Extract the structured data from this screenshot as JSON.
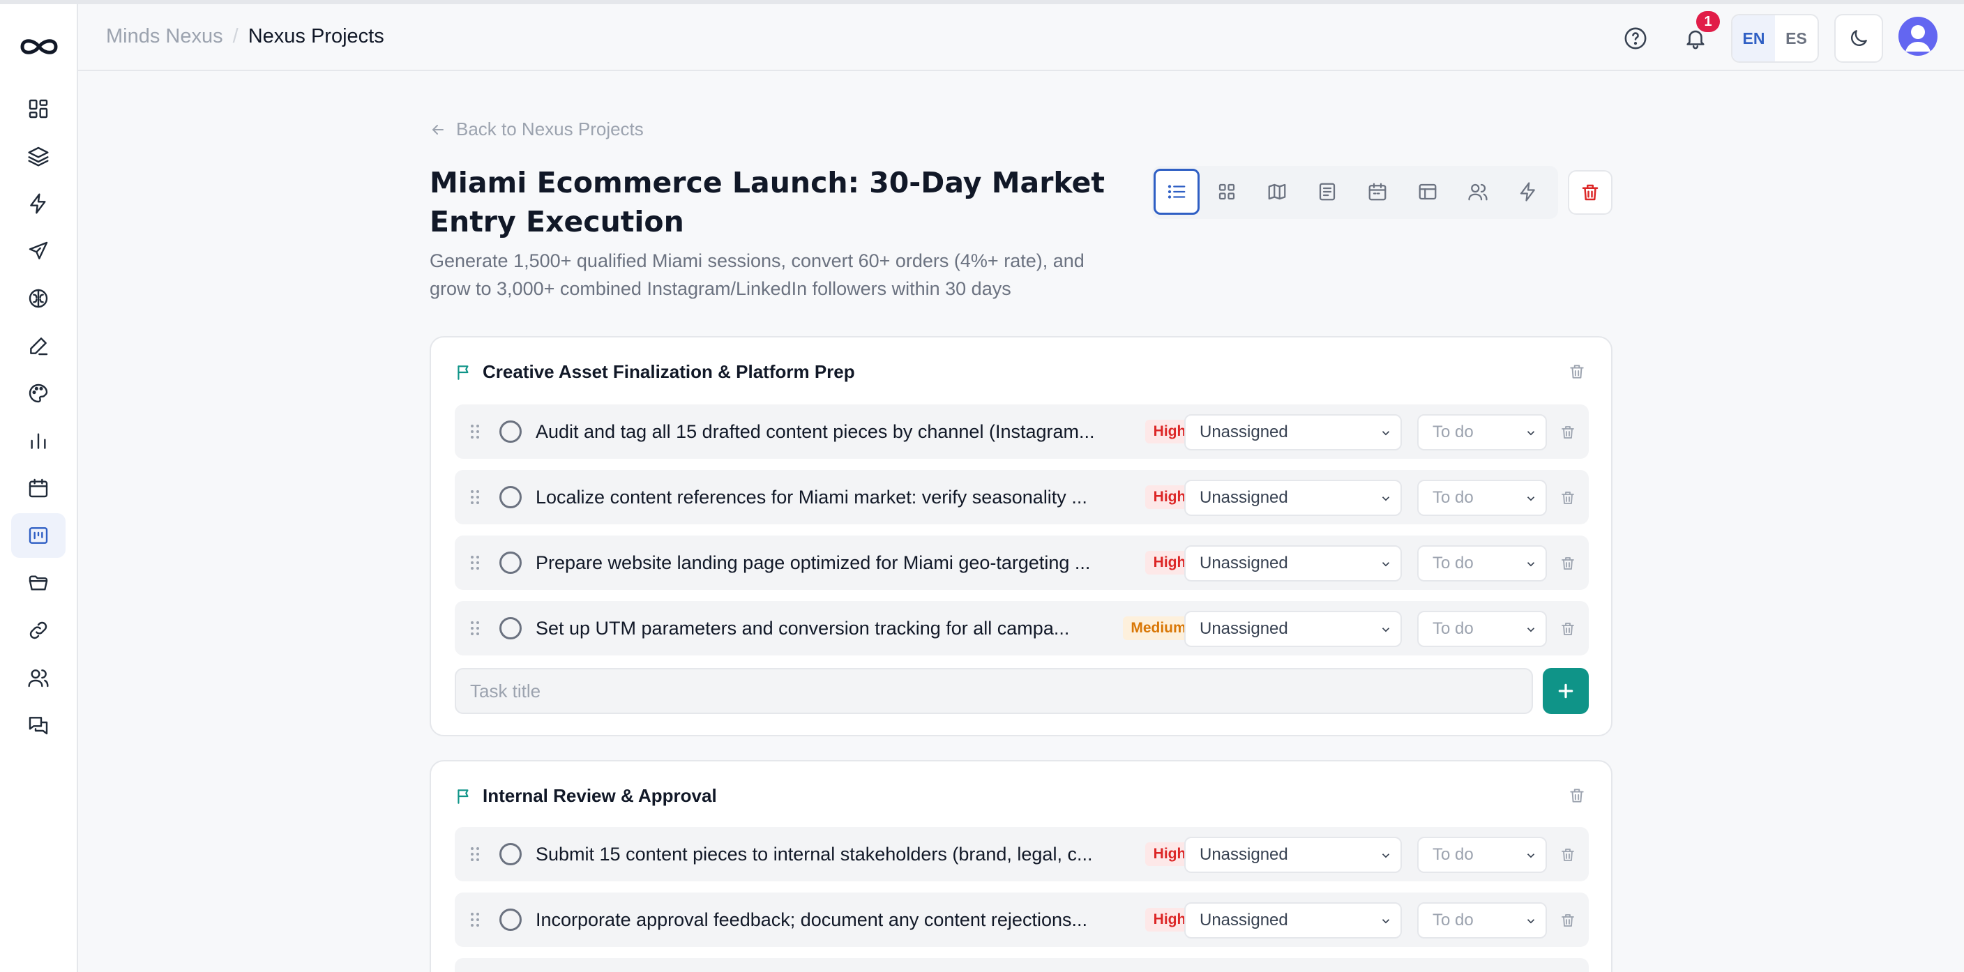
{
  "breadcrumb": {
    "root": "Minds Nexus",
    "current": "Nexus Projects"
  },
  "header": {
    "notification_count": "1",
    "lang_en": "EN",
    "lang_es": "ES"
  },
  "back_link": "Back to Nexus Projects",
  "project": {
    "title": "Miami Ecommerce Launch: 30-Day Market Entry Execution",
    "subtitle": "Generate 1,500+ qualified Miami sessions, convert 60+ orders (4%+ rate), and grow to 3,000+ combined Instagram/LinkedIn followers within 30 days"
  },
  "views": [
    "list-icon",
    "board-icon",
    "map-icon",
    "document-icon",
    "calendar-icon",
    "table-icon",
    "team-icon",
    "automation-icon"
  ],
  "sidebar": [
    "dashboard-icon",
    "layers-icon",
    "lightning-icon",
    "rocket-icon",
    "brain-icon",
    "pen-icon",
    "palette-icon",
    "bar-chart-icon",
    "calendar-icon",
    "projects-icon",
    "folder-icon",
    "link-icon",
    "users-icon",
    "chat-icon"
  ],
  "colors": {
    "accent": "#2f5fc4",
    "teal": "#0f9488",
    "high": "#dc2626",
    "medium": "#d97706"
  },
  "phases": [
    {
      "name": "Creative Asset Finalization & Platform Prep",
      "tasks": [
        {
          "title": "Audit and tag all 15 drafted content pieces by channel (Instagram...",
          "priority": "High",
          "assignee": "Unassigned",
          "status": "To do"
        },
        {
          "title": "Localize content references for Miami market: verify seasonality ...",
          "priority": "High",
          "assignee": "Unassigned",
          "status": "To do"
        },
        {
          "title": "Prepare website landing page optimized for Miami geo-targeting ...",
          "priority": "High",
          "assignee": "Unassigned",
          "status": "To do"
        },
        {
          "title": "Set up UTM parameters and conversion tracking for all campa...",
          "priority": "Medium",
          "assignee": "Unassigned",
          "status": "To do"
        }
      ],
      "add_placeholder": "Task title"
    },
    {
      "name": "Internal Review & Approval",
      "tasks": [
        {
          "title": "Submit 15 content pieces to internal stakeholders (brand, legal, c...",
          "priority": "High",
          "assignee": "Unassigned",
          "status": "To do"
        },
        {
          "title": "Incorporate approval feedback; document any content rejections...",
          "priority": "High",
          "assignee": "Unassigned",
          "status": "To do"
        }
      ]
    }
  ]
}
